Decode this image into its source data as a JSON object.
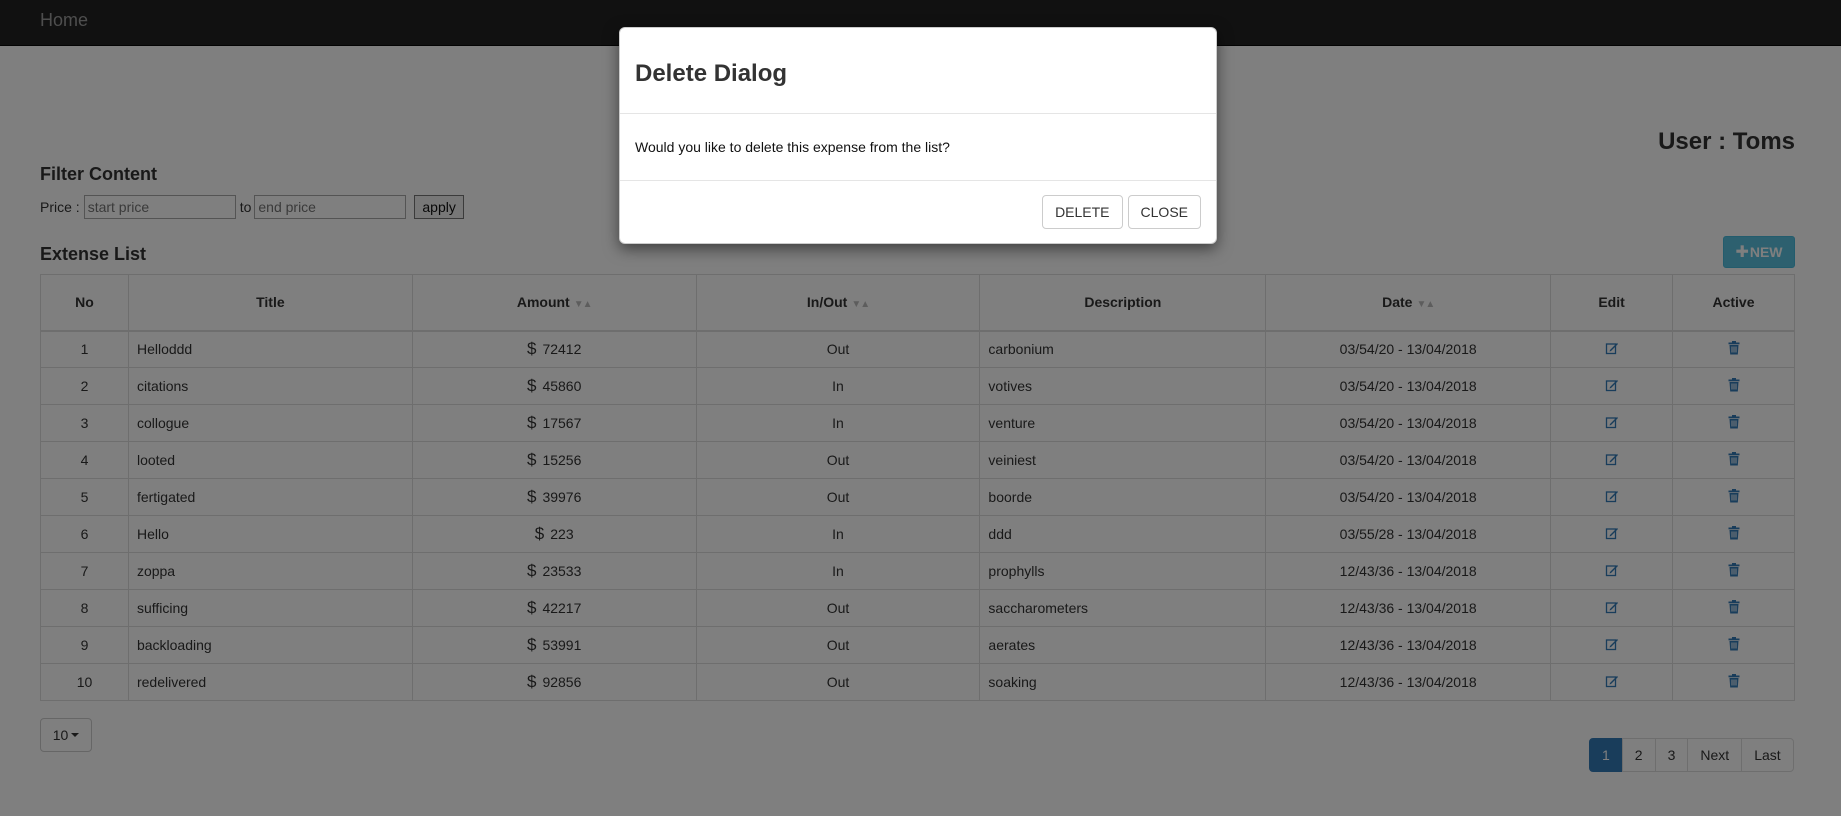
{
  "navbar": {
    "brand": "Home"
  },
  "user": {
    "label": "User : Toms"
  },
  "filter": {
    "title": "Filter Content",
    "price_label": "Price :",
    "start_placeholder": "start price",
    "to_label": "to",
    "end_placeholder": "end price",
    "apply_label": "apply"
  },
  "list": {
    "title": "Extense List",
    "new_label": "NEW",
    "columns": [
      "No",
      "Title",
      "Amount",
      "In/Out",
      "Description",
      "Date",
      "Edit",
      "Active"
    ],
    "currency": "$",
    "rows": [
      {
        "no": "1",
        "title": "Helloddd",
        "amount": "72412",
        "inout": "Out",
        "description": "carbonium",
        "date": "03/54/20 - 13/04/2018"
      },
      {
        "no": "2",
        "title": "citations",
        "amount": "45860",
        "inout": "In",
        "description": "votives",
        "date": "03/54/20 - 13/04/2018"
      },
      {
        "no": "3",
        "title": "collogue",
        "amount": "17567",
        "inout": "In",
        "description": "venture",
        "date": "03/54/20 - 13/04/2018"
      },
      {
        "no": "4",
        "title": "looted",
        "amount": "15256",
        "inout": "Out",
        "description": "veiniest",
        "date": "03/54/20 - 13/04/2018"
      },
      {
        "no": "5",
        "title": "fertigated",
        "amount": "39976",
        "inout": "Out",
        "description": "boorde",
        "date": "03/54/20 - 13/04/2018"
      },
      {
        "no": "6",
        "title": "Hello",
        "amount": "223",
        "inout": "In",
        "description": "ddd",
        "date": "03/55/28 - 13/04/2018"
      },
      {
        "no": "7",
        "title": "zoppa",
        "amount": "23533",
        "inout": "In",
        "description": "prophylls",
        "date": "12/43/36 - 13/04/2018"
      },
      {
        "no": "8",
        "title": "sufficing",
        "amount": "42217",
        "inout": "Out",
        "description": "saccharometers",
        "date": "12/43/36 - 13/04/2018"
      },
      {
        "no": "9",
        "title": "backloading",
        "amount": "53991",
        "inout": "Out",
        "description": "aerates",
        "date": "12/43/36 - 13/04/2018"
      },
      {
        "no": "10",
        "title": "redelivered",
        "amount": "92856",
        "inout": "Out",
        "description": "soaking",
        "date": "12/43/36 - 13/04/2018"
      }
    ]
  },
  "pagination": {
    "page_size": "10",
    "pages": [
      "1",
      "2",
      "3"
    ],
    "active_page": "1",
    "next_label": "Next",
    "last_label": "Last"
  },
  "dialog": {
    "title": "Delete Dialog",
    "message": "Would you like to delete this expense from the list?",
    "delete_label": "DELETE",
    "close_label": "CLOSE"
  },
  "colors": {
    "navbar": "#222222",
    "new_button": "#5bc0de",
    "active_page": "#337ab7",
    "icon": "#337ab7"
  }
}
